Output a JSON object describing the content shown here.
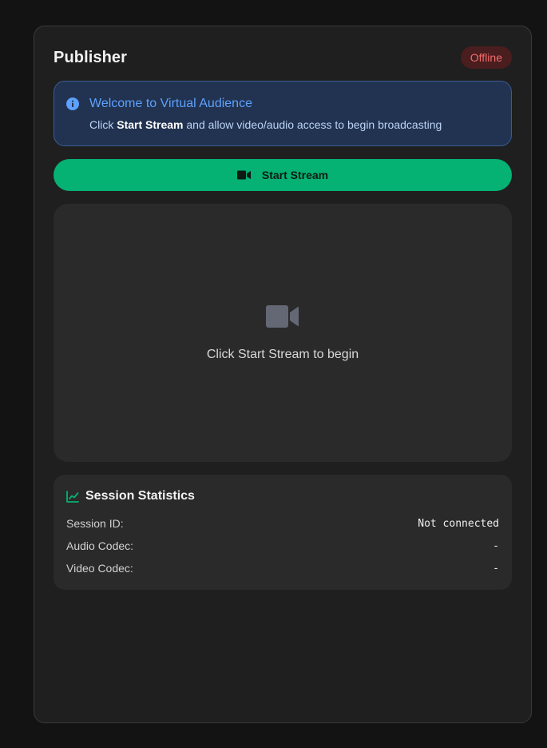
{
  "header": {
    "title": "Publisher",
    "status": "Offline"
  },
  "info": {
    "icon": "info-icon",
    "title": "Welcome to Virtual Audience",
    "text_prefix": "Click ",
    "text_bold": "Start Stream",
    "text_suffix": " and allow video/audio access to begin broadcasting"
  },
  "controls": {
    "start_label": "Start Stream",
    "start_icon": "video-camera-icon"
  },
  "video": {
    "placeholder_icon": "video-camera-icon",
    "placeholder_text": "Click Start Stream to begin"
  },
  "stats": {
    "icon": "chart-line-icon",
    "title": "Session Statistics",
    "rows": [
      {
        "label": "Session ID:",
        "value": "Not connected"
      },
      {
        "label": "Audio Codec:",
        "value": "-"
      },
      {
        "label": "Video Codec:",
        "value": "-"
      }
    ]
  },
  "colors": {
    "accent": "#05b173",
    "info": "#5ea1ff",
    "offline": "#f26b6b"
  }
}
